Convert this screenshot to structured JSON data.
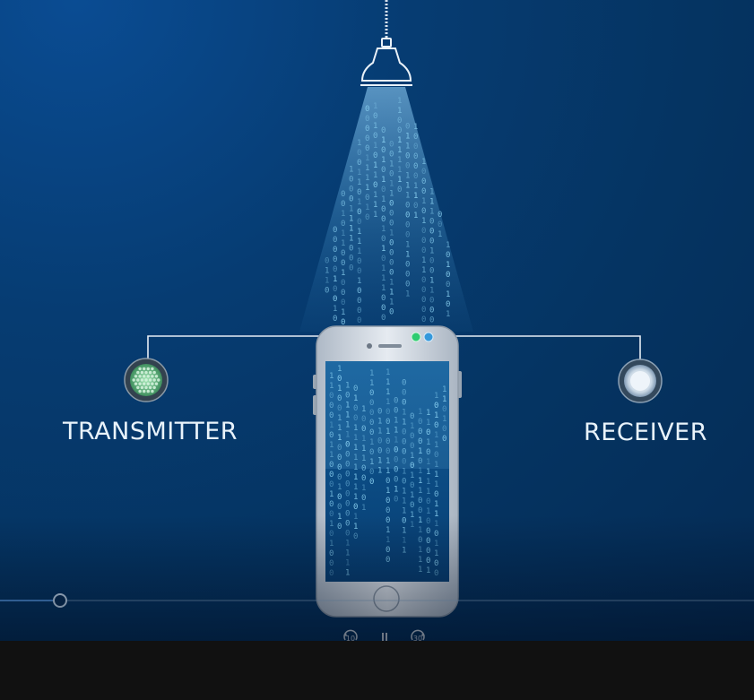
{
  "scene": {
    "transmitter_label": "TRANSMITTER",
    "receiver_label": "RECEIVER",
    "colors": {
      "background_top": "#0a4c93",
      "background_bottom": "#052b54",
      "line": "#e6edf5",
      "light_beam": "#8fd3ff",
      "binary_digits": "#8fd6f5",
      "transmitter_core": "#6fcf8f",
      "receiver_core": "#dfe9f2",
      "camera_dot_green": "#2ecc71",
      "camera_dot_blue": "#3498db"
    }
  },
  "player": {
    "progress_fraction": 0.078,
    "rewind_seconds": "10",
    "forward_seconds": "30",
    "rewind_icon": "rewind-10-icon",
    "pause_icon": "pause-icon",
    "forward_icon": "forward-30-icon"
  }
}
